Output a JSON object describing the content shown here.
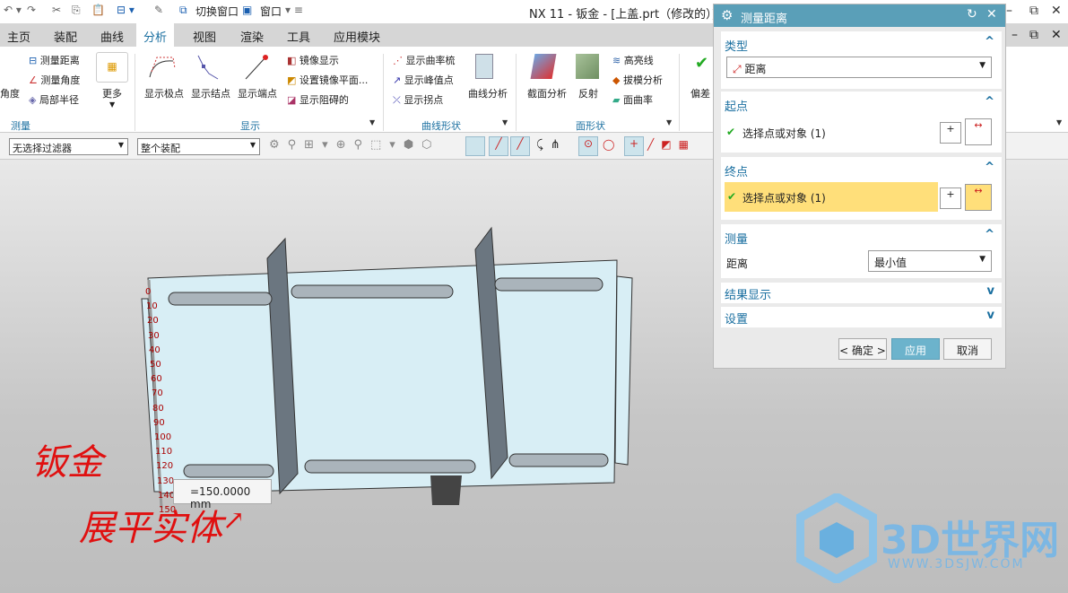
{
  "window": {
    "title": "NX 11 - 钣金 - [上盖.prt（修改的）]",
    "switch_window": "切换窗口",
    "window_menu": "窗口"
  },
  "tabs": [
    "主页",
    "装配",
    "曲线",
    "分析",
    "视图",
    "渲染",
    "工具",
    "应用模块"
  ],
  "active_tab": "分析",
  "ribbon": {
    "measure": {
      "label": "测量",
      "items": [
        "角度",
        "测量距离",
        "测量角度",
        "局部半径",
        "更多"
      ]
    },
    "display": {
      "label": "显示",
      "items": [
        "显示极点",
        "显示结点",
        "显示端点",
        "镜像显示",
        "设置镜像平面...",
        "显示阻碍的"
      ]
    },
    "curve_shape": {
      "label": "曲线形状",
      "items": [
        "显示曲率梳",
        "显示峰值点",
        "显示拐点",
        "曲线分析"
      ]
    },
    "face_shape": {
      "label": "面形状",
      "items": [
        "截面分析",
        "反射",
        "高亮线",
        "拔模分析",
        "面曲率"
      ]
    },
    "extra": {
      "items": [
        "偏差"
      ]
    }
  },
  "toolbar": {
    "filter": "无选择过滤器",
    "scope": "整个装配"
  },
  "dialog": {
    "title": "测量距离",
    "type": {
      "header": "类型",
      "value": "距离"
    },
    "start": {
      "header": "起点",
      "select": "选择点或对象 (1)"
    },
    "end": {
      "header": "终点",
      "select": "选择点或对象 (1)"
    },
    "measure": {
      "header": "测量",
      "label": "距离",
      "value": "最小值"
    },
    "results": {
      "header": "结果显示"
    },
    "settings": {
      "header": "设置"
    },
    "ok": "< 确定 >",
    "apply": "应用",
    "cancel": "取消",
    "accent": "#5a9fb8",
    "highlight": "#ffdf7a"
  },
  "viewport": {
    "ruler_ticks": [
      "0",
      "10",
      "20",
      "30",
      "40",
      "50",
      "60",
      "70",
      "80",
      "90",
      "100",
      "110",
      "120",
      "130",
      "140",
      "150"
    ],
    "measurement": "=150.0000 mm",
    "annotation1": "钣金",
    "annotation2": "展平实体",
    "watermark": "3D世界网",
    "watermark_url": "WWW.3DSJW.COM"
  }
}
